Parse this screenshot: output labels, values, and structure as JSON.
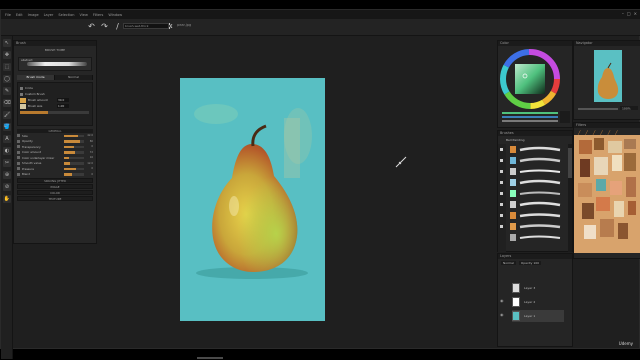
{
  "menu": [
    "File",
    "Edit",
    "Image",
    "Layer",
    "Selection",
    "View",
    "Filters",
    "Window"
  ],
  "window_controls": [
    "–",
    "□",
    "×"
  ],
  "options_bar": {
    "title_field_value": "brush-wet-thick",
    "filename": "pear.jpg"
  },
  "left_tools": [
    "↖",
    "✥",
    "⬚",
    "◯",
    "✎",
    "⌫",
    "🖌",
    "🪣",
    "A",
    "◐",
    "✂",
    "⊕",
    "⊘",
    "✋"
  ],
  "brush_panel": {
    "title": "Brush",
    "header": "BRUSH TOME",
    "brush_name": "abstract",
    "tabs": [
      "Brush mode",
      "Normal"
    ],
    "sub_rows": [
      {
        "label": "Circle",
        "value": ""
      },
      {
        "label": "Custom Brush",
        "value": ""
      },
      {
        "label": "Brush amount",
        "value": "30.0"
      },
      {
        "label": "Brush size",
        "value": "1.00"
      }
    ],
    "section_label": "GENERAL",
    "params": [
      {
        "label": "Size",
        "value": "42.0",
        "level": 0.72
      },
      {
        "label": "Opacity",
        "value": "80",
        "level": 0.8
      },
      {
        "label": "Transparency",
        "value": "0",
        "level": 0.5
      },
      {
        "label": "Color amount",
        "value": "72",
        "level": 0.55
      },
      {
        "label": "Color underlayer mixer",
        "value": "16",
        "level": 0.25
      },
      {
        "label": "Smooth value",
        "value": "12.0",
        "level": 0.3
      },
      {
        "label": "Pressure",
        "value": "0",
        "level": 0.6
      },
      {
        "label": "Blend",
        "value": "0",
        "level": 0.4
      }
    ],
    "collapsed_sections": [
      "SPACING JITTER",
      "IMAGE",
      "COLOR",
      "TEXTURE"
    ]
  },
  "color_panel": {
    "title": "Color",
    "accent": "#4fc17e"
  },
  "navigator_panel": {
    "title": "Navigator",
    "zoom": "100%"
  },
  "brushes_panel": {
    "title": "Brushes",
    "set": "Bell Painting"
  },
  "filter_panel": {
    "title": "Filters"
  },
  "layers_panel": {
    "title": "Layers",
    "mode": "Normal",
    "opacity": "Opacity 100",
    "layers": [
      {
        "name": "Layer 3"
      },
      {
        "name": "Layer 2"
      },
      {
        "name": "Layer 1"
      }
    ]
  },
  "watermark": "Udemy"
}
